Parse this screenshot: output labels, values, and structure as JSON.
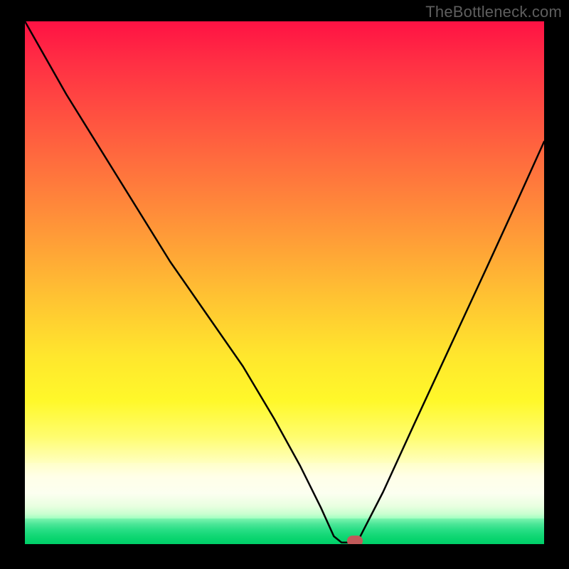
{
  "watermark": "TheBottleneck.com",
  "chart_data": {
    "type": "line",
    "title": "",
    "xlabel": "",
    "ylabel": "",
    "xlim": [
      0,
      100
    ],
    "ylim": [
      0,
      100
    ],
    "series": [
      {
        "name": "bottleneck-curve",
        "x": [
          0,
          8,
          18,
          28,
          35,
          42,
          48,
          53,
          57,
          59.5,
          61,
          63,
          64.5,
          69,
          75,
          82,
          89,
          95,
          100
        ],
        "values": [
          100,
          86,
          70,
          54,
          44,
          34,
          24,
          15,
          7,
          1.5,
          0.3,
          0.3,
          1.3,
          10,
          23,
          38,
          53,
          66,
          77
        ]
      }
    ],
    "background_bands": [
      {
        "name": "red-yellow-gradient",
        "from_y": 16,
        "to_y": 100
      },
      {
        "name": "light-yellow-band",
        "from_y": 5,
        "to_y": 16
      },
      {
        "name": "green-band",
        "from_y": 0,
        "to_y": 5
      }
    ],
    "marker": {
      "x": 63.5,
      "y": 0.5,
      "color": "#c15a5a"
    }
  }
}
